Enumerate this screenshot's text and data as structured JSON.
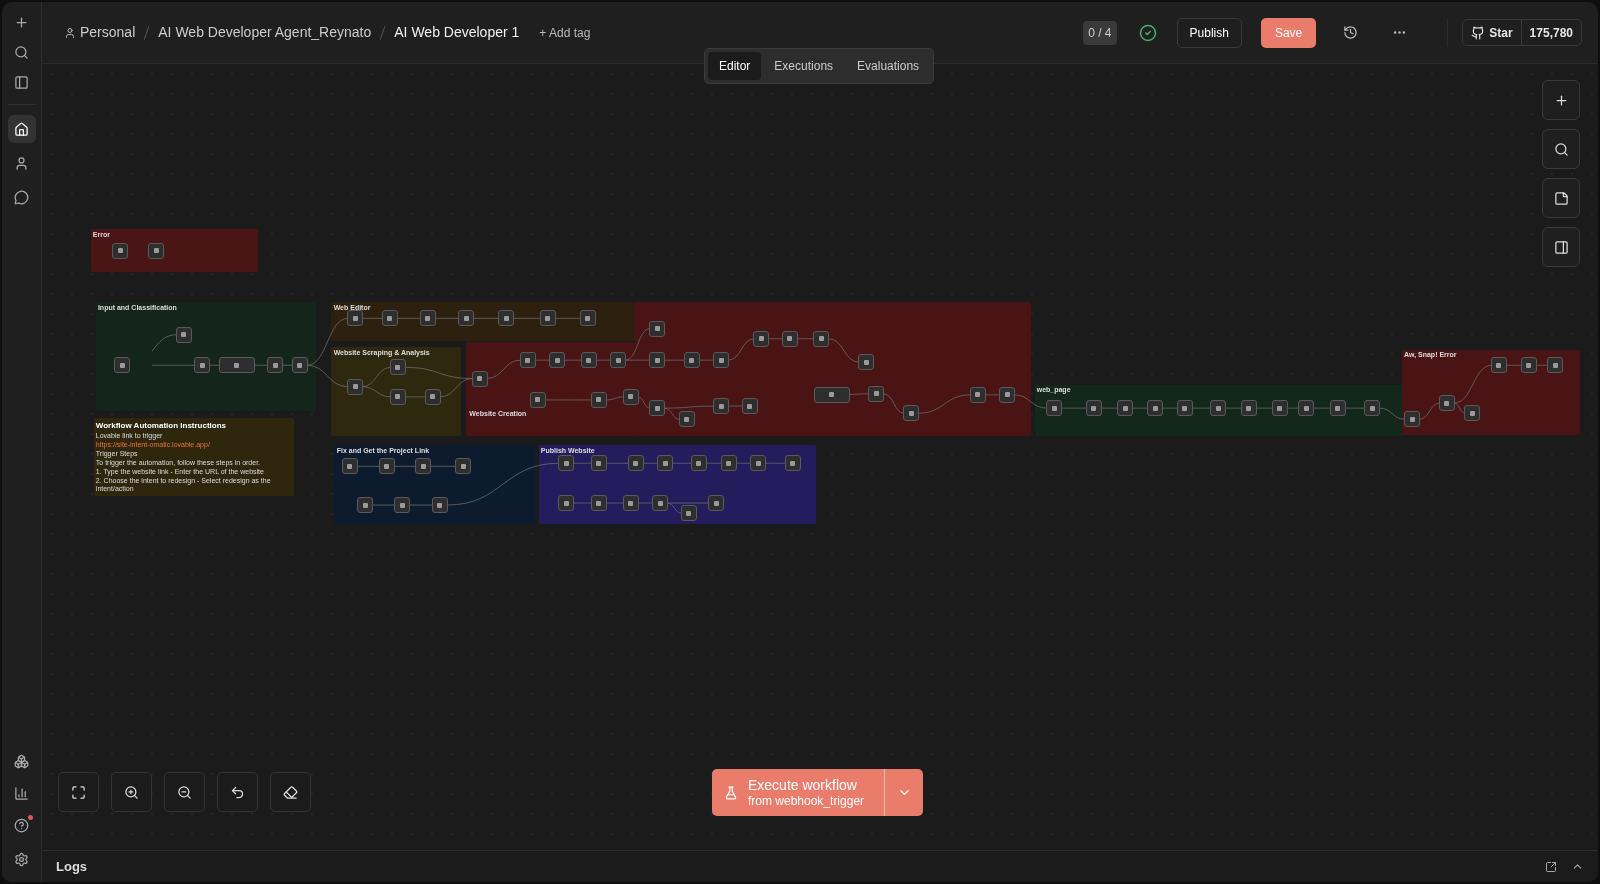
{
  "breadcrumb": {
    "project": "Personal",
    "folder": "AI Web Developer Agent_Reynato",
    "workflow": "AI Web Developer 1",
    "add_tag": "+ Add tag"
  },
  "header": {
    "counter": "0 / 4",
    "publish": "Publish",
    "save": "Save",
    "github": {
      "label": "Star",
      "count": "175,780"
    }
  },
  "tabs": [
    {
      "label": "Editor",
      "selected": true
    },
    {
      "label": "Executions",
      "selected": false
    },
    {
      "label": "Evaluations",
      "selected": false
    }
  ],
  "sidebar": {
    "nav": [
      {
        "selected": true
      },
      {
        "selected": false
      },
      {
        "selected": false
      }
    ],
    "help_notification": true
  },
  "sticky_notes": [
    {
      "title": "Error",
      "color": "#4a1515"
    },
    {
      "title": "Input and Classification",
      "color": "#14261c"
    },
    {
      "title": "Web Editor",
      "color": "#2e200f"
    },
    {
      "title": "Website Scraping & Analysis",
      "color": "#2e290e"
    },
    {
      "title": "Website Creation",
      "color": "#4a1414"
    },
    {
      "title": "web_page",
      "color": "#14271b"
    },
    {
      "title": "Aw, Snap! Error",
      "color": "#4a1414"
    },
    {
      "title": "Fix and Get the Project Link",
      "color": "#0d1b2f"
    },
    {
      "title": "Publish Website",
      "color": "#251c5e"
    }
  ],
  "instructions": {
    "title": "Workflow Automation Instructions",
    "color": "#2e270d",
    "lines": [
      {
        "kind": "text",
        "text": "Lovable link to trigger"
      },
      {
        "kind": "link",
        "text": "https://site-intent-omatic.lovable.app/"
      },
      {
        "kind": "text",
        "text": "Trigger Steps"
      },
      {
        "kind": "text",
        "text": "To trigger the automation, follow these steps in order."
      },
      {
        "kind": "text",
        "text": "1. Type the website link - Enter the URL of the website"
      },
      {
        "kind": "text",
        "text": "2. Choose the intent to redesign - Select redesign as the intent/action"
      }
    ]
  },
  "execute": {
    "title": "Execute workflow",
    "subtitle": "from webhook_trigger"
  },
  "logs": {
    "label": "Logs"
  }
}
